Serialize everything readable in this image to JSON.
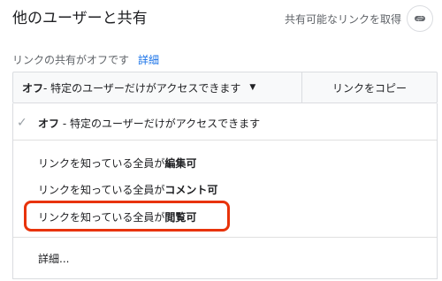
{
  "dialog": {
    "title": "他のユーザーと共有",
    "get_link_label": "共有可能なリンクを取得",
    "get_link_icon": "link-icon"
  },
  "status": {
    "text": "リンクの共有がオフです",
    "detail_link": "詳細"
  },
  "toolbar": {
    "scope_bold": "オフ",
    "scope_rest": " - 特定のユーザーだけがアクセスできます",
    "caret_icon": "chevron-down-icon",
    "copy_link": "リンクをコピー"
  },
  "menu": {
    "selected_icon": "checkmark-icon",
    "item_off_bold": "オフ",
    "item_off_rest": " - 特定のユーザーだけがアクセスできます",
    "item_edit_prefix": "リンクを知っている全員が",
    "item_edit_bold": "編集可",
    "item_comment_prefix": "リンクを知っている全員が",
    "item_comment_bold": "コメント可",
    "item_view_prefix": "リンクを知っている全員が",
    "item_view_bold": "閲覧可",
    "more": "詳細..."
  },
  "colors": {
    "link": "#1a73e8",
    "highlight": "#e8330a"
  }
}
